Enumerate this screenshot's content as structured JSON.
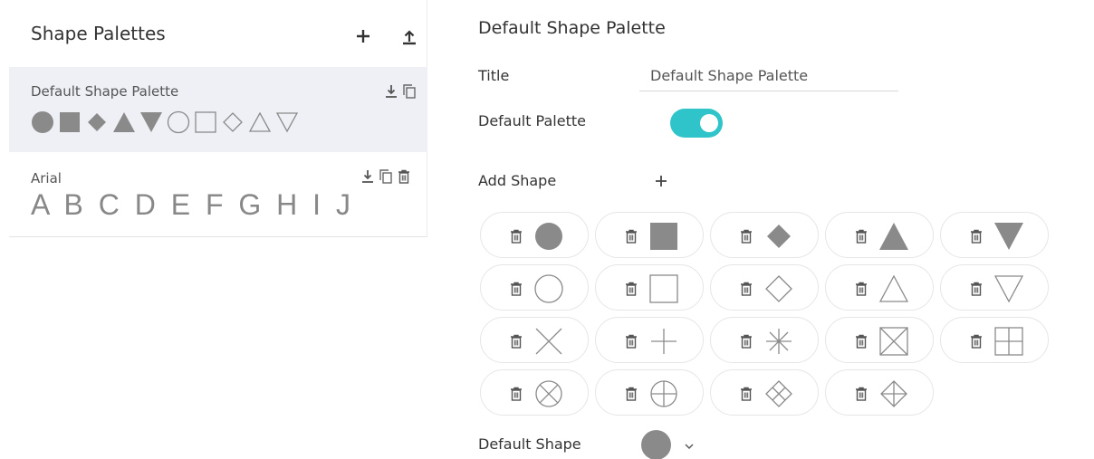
{
  "sidebar": {
    "title": "Shape Palettes",
    "palettes": [
      {
        "name": "Default Shape Palette",
        "shapes": [
          "circle",
          "square",
          "diamond",
          "triangle-up",
          "triangle-down",
          "circle-outline",
          "square-outline",
          "diamond-outline",
          "triangle-up-outline",
          "triangle-down-outline"
        ]
      },
      {
        "name": "Arial",
        "letters": "A B C D E F G H I J"
      }
    ]
  },
  "detail": {
    "heading": "Default Shape Palette",
    "title_label": "Title",
    "title_value": "Default Shape Palette",
    "default_palette_label": "Default Palette",
    "default_palette_on": true,
    "add_shape_label": "Add Shape",
    "default_shape_label": "Default Shape",
    "default_shape": "circle",
    "shapes": [
      "circle",
      "square",
      "diamond",
      "triangle-up",
      "triangle-down",
      "circle-outline",
      "square-outline",
      "diamond-outline",
      "triangle-up-outline",
      "triangle-down-outline",
      "x-cross",
      "plus",
      "asterisk",
      "square-x",
      "square-plus",
      "circle-x",
      "circle-plus",
      "diamond-x",
      "diamond-plus"
    ]
  },
  "colors": {
    "accent": "#2ec4c9",
    "shape_fill": "#8a8a8a",
    "selected_bg": "#eef0f6"
  }
}
